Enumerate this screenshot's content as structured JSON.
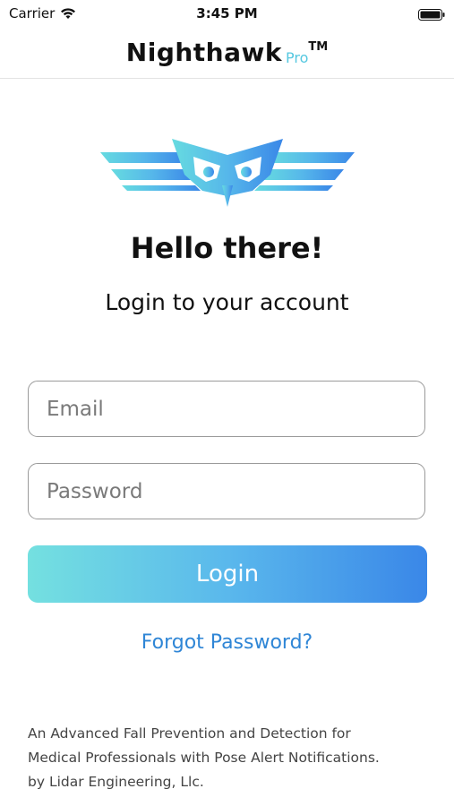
{
  "status_bar": {
    "carrier": "Carrier",
    "time": "3:45 PM",
    "icons": [
      "wifi-icon",
      "battery-icon"
    ]
  },
  "nav": {
    "app_name": "Nighthawk",
    "edition": "Pro",
    "trademark": "TM"
  },
  "logo": {
    "icon": "owl-wings-logo",
    "colors": [
      "#5fd3e3",
      "#3a87e8"
    ]
  },
  "login": {
    "greeting": "Hello there!",
    "subtitle": "Login to your account",
    "email_placeholder": "Email",
    "email_value": "",
    "password_placeholder": "Password",
    "password_value": "",
    "login_label": "Login",
    "forgot_label": "Forgot Password?"
  },
  "footer": {
    "lines": [
      "An Advanced Fall Prevention and Detection for",
      "Medical Professionals with Pose Alert Notifications.",
      "by Lidar Engineering, Llc."
    ]
  },
  "colors": {
    "accent": "#2f86d6",
    "gradient_start": "#74e0e0",
    "gradient_end": "#3a87e8",
    "pro_text": "#56c8e0"
  }
}
